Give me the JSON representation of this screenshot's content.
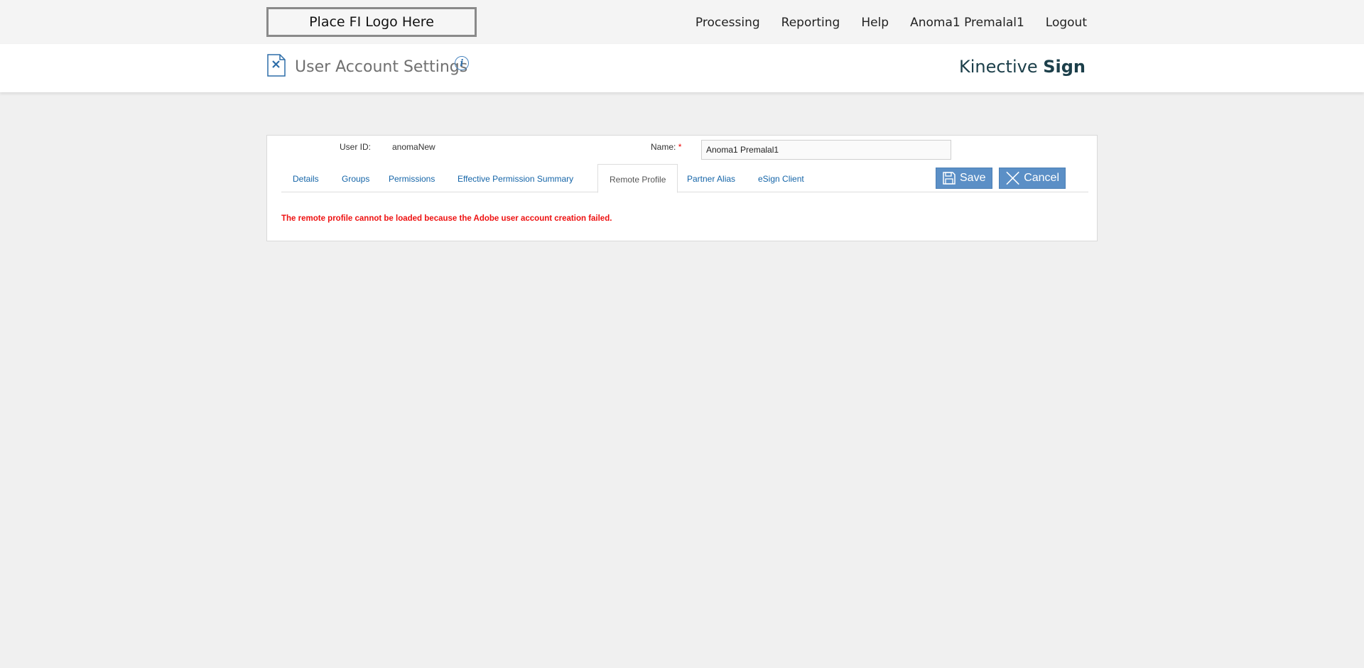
{
  "topbar": {
    "logo_text": "Place FI Logo Here",
    "nav": [
      "Processing",
      "Reporting",
      "Help",
      "Anoma1 Premalal1",
      "Logout"
    ]
  },
  "header": {
    "title": "User Account Settings",
    "info_icon": "i",
    "brand_part1": "Kinective ",
    "brand_part2": "Sign"
  },
  "form": {
    "user_id_label": "User ID:",
    "user_id_value": "anomaNew",
    "name_label": "Name:",
    "required_mark": "*",
    "name_value": "Anoma1 Premalal1"
  },
  "tabs": [
    "Details",
    "Groups",
    "Permissions",
    "Effective Permission Summary",
    "Remote Profile",
    "Partner Alias",
    "eSign Client"
  ],
  "active_tab": "Remote Profile",
  "buttons": {
    "save": "Save",
    "cancel": "Cancel"
  },
  "message": "The remote profile cannot be loaded because the Adobe user account creation failed.",
  "colors": {
    "accent": "#5b8fc6",
    "link": "#1565a8",
    "error": "#ee1111",
    "brand": "#1c3f4a"
  }
}
